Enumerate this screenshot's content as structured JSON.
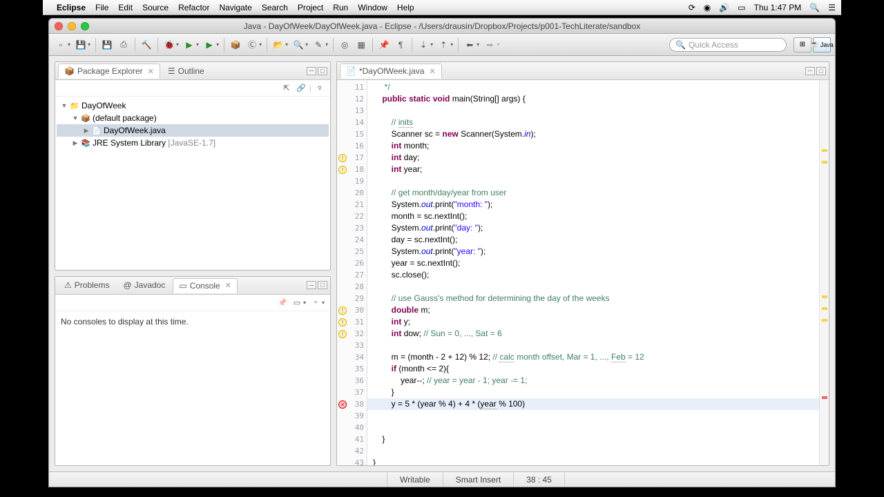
{
  "menubar": {
    "app": "Eclipse",
    "items": [
      "File",
      "Edit",
      "Source",
      "Refactor",
      "Navigate",
      "Search",
      "Project",
      "Run",
      "Window",
      "Help"
    ],
    "clock": "Thu 1:47 PM"
  },
  "window": {
    "title": "Java - DayOfWeek/DayOfWeek.java - Eclipse - /Users/drausin/Dropbox/Projects/p001-TechLiterate/sandbox",
    "quick_access_placeholder": "Quick Access",
    "perspective": "Java"
  },
  "package_explorer": {
    "tab_label": "Package Explorer",
    "outline_label": "Outline",
    "tree": {
      "project": "DayOfWeek",
      "package": "(default package)",
      "file": "DayOfWeek.java",
      "jre": "JRE System Library",
      "jre_suffix": "[JavaSE-1.7]"
    }
  },
  "bottom_view": {
    "tabs": [
      "Problems",
      "Javadoc",
      "Console"
    ],
    "active": 2,
    "body": "No consoles to display at this time."
  },
  "editor": {
    "tab_label": "*DayOfWeek.java",
    "first_line_no": 11,
    "gutter_marks": {
      "17": "warn",
      "18": "warn",
      "30": "warn",
      "31": "warn",
      "32": "warn",
      "38": "err"
    },
    "highlight_line": 38,
    "lines": [
      {
        "html": "     */",
        "cls": "cm"
      },
      {
        "html": "    <span class='kw'>public static void</span> main(String[] args) {"
      },
      {
        "html": ""
      },
      {
        "html": "        <span class='cm'>// <span class='uline'>inits</span></span>"
      },
      {
        "html": "        Scanner sc = <span class='kw'>new</span> Scanner(System.<span class='fld'>in</span>);"
      },
      {
        "html": "        <span class='kw'>int</span> month;"
      },
      {
        "html": "        <span class='kw'>int</span> day;"
      },
      {
        "html": "        <span class='kw'>int</span> year;"
      },
      {
        "html": ""
      },
      {
        "html": "        <span class='cm'>// get month/day/year from user</span>"
      },
      {
        "html": "        System.<span class='fld'>out</span>.print(<span class='st'>\"month: \"</span>);"
      },
      {
        "html": "        month = sc.nextInt();"
      },
      {
        "html": "        System.<span class='fld'>out</span>.print(<span class='st'>\"day: \"</span>);"
      },
      {
        "html": "        day = sc.nextInt();"
      },
      {
        "html": "        System.<span class='fld'>out</span>.print(<span class='st'>\"year: \"</span>);"
      },
      {
        "html": "        year = sc.nextInt();"
      },
      {
        "html": "        sc.close();"
      },
      {
        "html": ""
      },
      {
        "html": "        <span class='cm'>// use Gauss's method for determining the day of the weeks</span>"
      },
      {
        "html": "        <span class='kw'>double</span> m;"
      },
      {
        "html": "        <span class='kw'>int</span> y;"
      },
      {
        "html": "        <span class='kw'>int</span> dow; <span class='cm'>// Sun = 0, ..., Sat = 6</span>"
      },
      {
        "html": ""
      },
      {
        "html": "        m = (month - 2 + 12) % 12; <span class='cm'>// <span class='uline'>calc</span> month offset, Mar = 1, ..., <span class='uline'>Feb</span> = 12</span>"
      },
      {
        "html": "        <span class='kw'>if</span> (month &lt;= 2){"
      },
      {
        "html": "            year--; <span class='cm'>// year = year - 1; year -= 1;</span>"
      },
      {
        "html": "        }"
      },
      {
        "html": "        y = 5 * (year % 4) + 4 * (<span class='uline'>year</span> % 100)"
      },
      {
        "html": ""
      },
      {
        "html": ""
      },
      {
        "html": "    }"
      },
      {
        "html": ""
      },
      {
        "html": "}"
      }
    ]
  },
  "status": {
    "writable": "Writable",
    "insert": "Smart Insert",
    "pos": "38 : 45"
  }
}
